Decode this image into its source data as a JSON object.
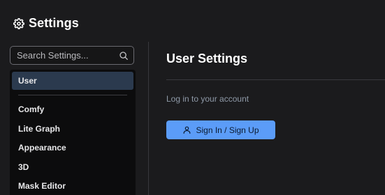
{
  "header": {
    "title": "Settings",
    "icon": "gear-icon"
  },
  "search": {
    "placeholder": "Search Settings...",
    "value": "",
    "icon": "search-icon"
  },
  "sidebar": {
    "items": [
      {
        "label": "User",
        "active": true
      },
      {
        "label": "Comfy",
        "active": false
      },
      {
        "label": "Lite Graph",
        "active": false
      },
      {
        "label": "Appearance",
        "active": false
      },
      {
        "label": "3D",
        "active": false
      },
      {
        "label": "Mask Editor",
        "active": false
      }
    ]
  },
  "main": {
    "title": "User Settings",
    "subtitle": "Log in to your account",
    "signin_label": "Sign In / Sign Up",
    "signin_icon": "user-icon"
  },
  "colors": {
    "background": "#1b1b1d",
    "sidebar_bg": "#0c0c0d",
    "active_item": "#2b3a4e",
    "accent_button": "#5b9cf8",
    "subtitle_text": "#8f9aa8"
  }
}
